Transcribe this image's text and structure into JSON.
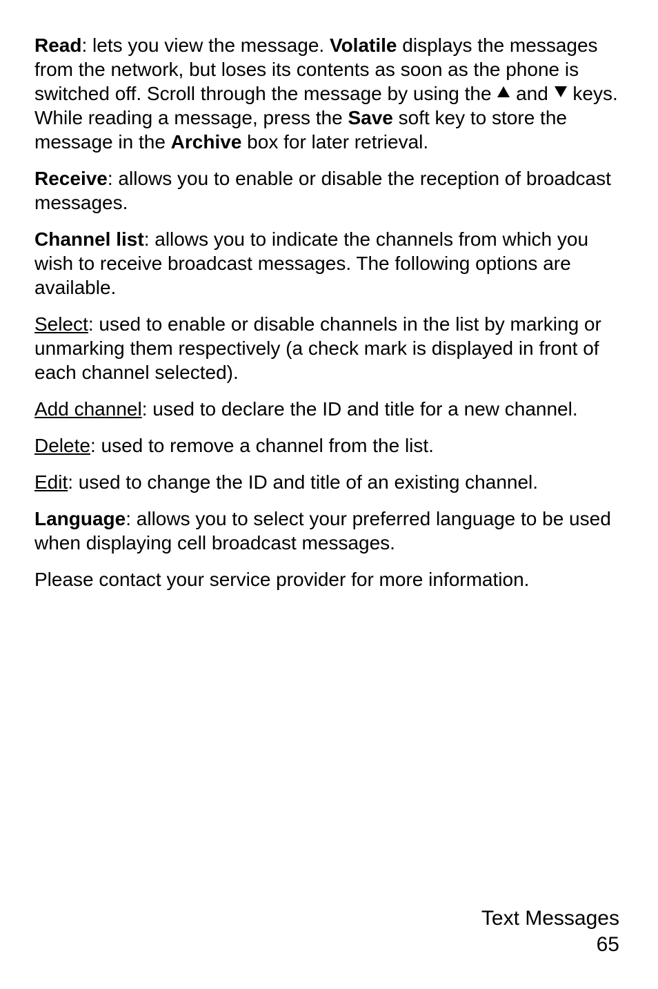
{
  "p1": {
    "b1": "Read",
    "t1": ": lets you view the message. ",
    "b2": "Volatile",
    "t2": " displays the messages from the network, but loses its contents as soon as the phone is switched off. Scroll through the message by using the ",
    "t3": " and ",
    "t4": " keys. While reading a message, press the ",
    "b3": "Save",
    "t5": " soft key to store the message in the ",
    "b4": "Archive",
    "t6": " box for later retrieval."
  },
  "p2": {
    "b1": "Receive",
    "t1": ": allows you to enable or disable the reception of broadcast messages."
  },
  "p3": {
    "b1": "Channel list",
    "t1": ": allows you to indicate the channels from which you wish to receive broadcast messages. The following options are available."
  },
  "p4": {
    "u1": "Select",
    "t1": ": used to enable or disable channels in the list by marking or unmarking them respectively (a check mark is displayed in front of each channel selected)."
  },
  "p5": {
    "u1": "Add channel",
    "t1": ": used to declare the ID and title for a new channel."
  },
  "p6": {
    "u1": "Delete",
    "t1": ": used to remove a channel from the list."
  },
  "p7": {
    "u1": "Edit",
    "t1": ": used to change the ID and title of an existing channel."
  },
  "p8": {
    "b1": "Language",
    "t1": ": allows you to select your preferred language to be used when displaying cell broadcast messages."
  },
  "p9": {
    "t1": "Please contact your service provider for more information."
  },
  "footer": {
    "section": "Text Messages",
    "page": "65"
  }
}
